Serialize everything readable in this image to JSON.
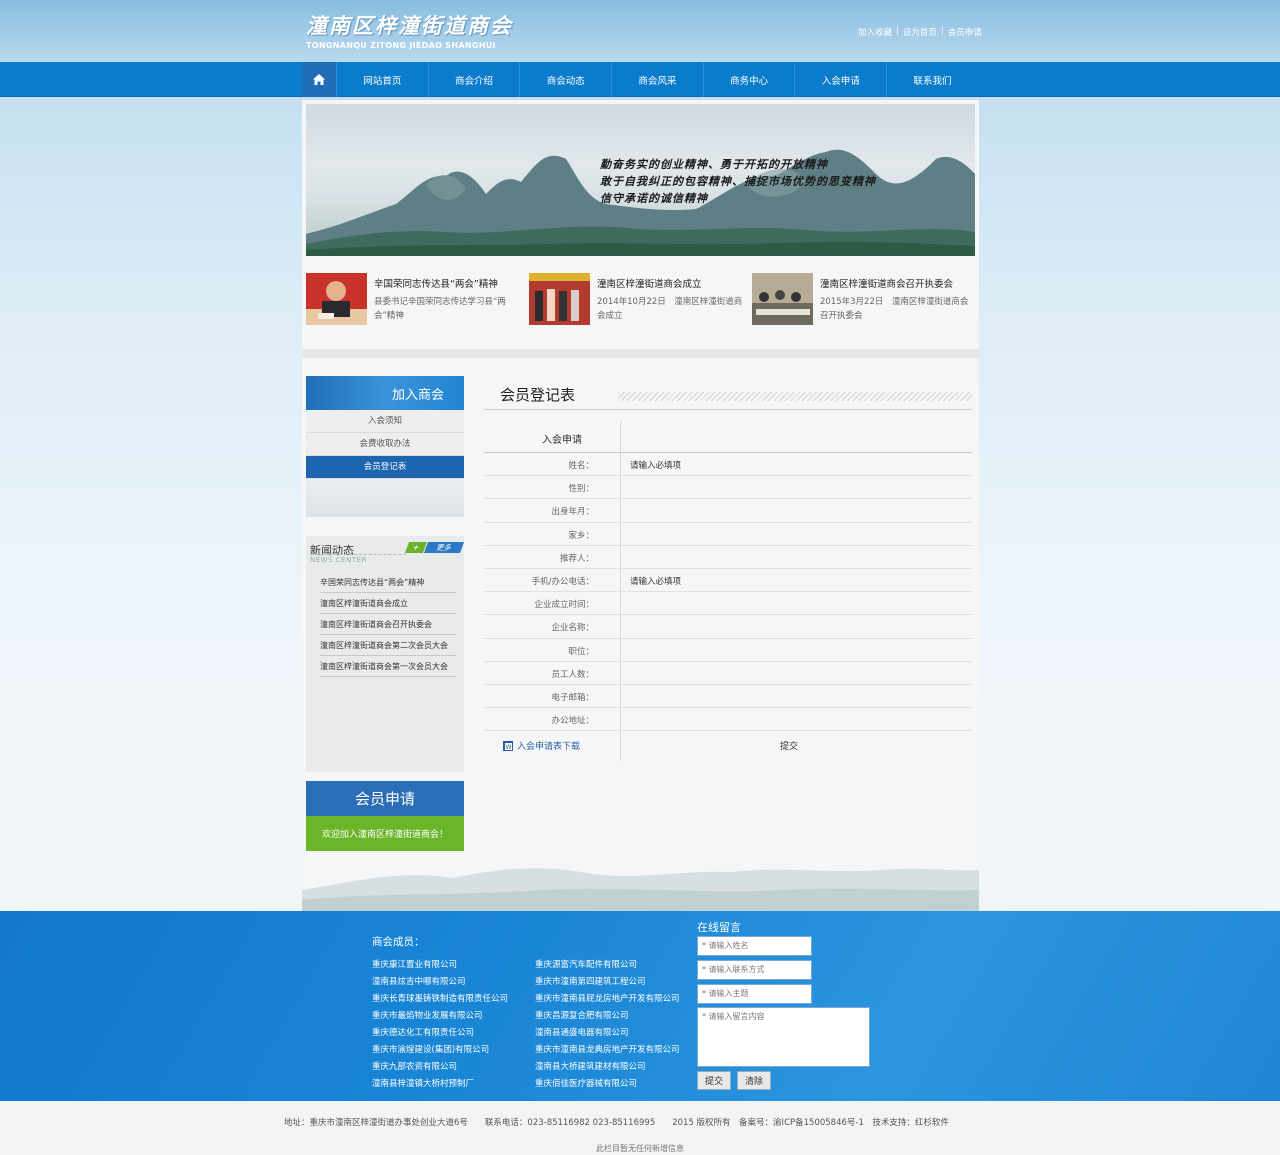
{
  "header": {
    "logo_cn": "潼南区梓潼街道商会",
    "logo_en": "TONGNANQU  ZITONG JIEDAO SHANGHUI",
    "links": [
      "加入收藏",
      "设为首页",
      "会员申请"
    ]
  },
  "nav": {
    "items": [
      "网站首页",
      "商会介绍",
      "商会动态",
      "商会风采",
      "商务中心",
      "入会申请",
      "联系我们"
    ]
  },
  "banner": {
    "slogan": [
      "勤奋务实的创业精神、勇于开拓的开放精神",
      "敢于自我纠正的包容精神、捕捉市场优势的思变精神",
      "信守承诺的诚信精神"
    ]
  },
  "news_cards": [
    {
      "title": "辛国荣同志传达县“两会”精神",
      "desc": "县委书记辛国荣同志传达学习县“两会”精神"
    },
    {
      "title": "潼南区梓潼街道商会成立",
      "desc": "2014年10月22日　潼南区梓潼街道商会成立"
    },
    {
      "title": "潼南区梓潼街道商会召开执委会",
      "desc": "2015年3月22日　潼南区梓潼街道商会召开执委会"
    }
  ],
  "sidebar": {
    "title": "加入商会",
    "items": [
      "入会须知",
      "会费收取办法",
      "会员登记表"
    ]
  },
  "newsbox": {
    "title": "新闻动态",
    "subtitle": "NEWS CENTER",
    "more_plus": "+",
    "more": "更多",
    "items": [
      "辛国荣同志传达县“两会”精神",
      "潼南区梓潼街道商会成立",
      "潼南区梓潼街道商会召开执委会",
      "潼南区梓潼街道商会第二次会员大会",
      "潼南区梓潼街道商会第一次会员大会"
    ]
  },
  "member_box": {
    "title": "会员申请",
    "welcome": "欢迎加入潼南区梓潼街道商会！"
  },
  "form": {
    "title": "会员登记表",
    "head": "入会申请",
    "rows": [
      {
        "label": "姓名：",
        "value": "请输入必填项"
      },
      {
        "label": "性别：",
        "value": ""
      },
      {
        "label": "出身年月：",
        "value": ""
      },
      {
        "label": "家乡：",
        "value": ""
      },
      {
        "label": "推荐人：",
        "value": ""
      },
      {
        "label": "手机/办公电话：",
        "value": "请输入必填项"
      },
      {
        "label": "企业成立时间：",
        "value": ""
      },
      {
        "label": "企业名称：",
        "value": ""
      },
      {
        "label": "职位：",
        "value": ""
      },
      {
        "label": "员工人数：",
        "value": ""
      },
      {
        "label": "电子邮箱：",
        "value": ""
      },
      {
        "label": "办公地址：",
        "value": ""
      }
    ],
    "download": "入会申请表下载",
    "submit": "提交"
  },
  "footer": {
    "members_title": "商会成员：",
    "members_left": [
      "重庆康江置业有限公司",
      "潼南县炫吉中哪有限公司",
      "重庆长青球墨铸铁制造有限责任公司",
      "重庆市最焰物业发展有限公司",
      "重庆德达化工有限责任公司",
      "重庆市渝煌建设(集团)有限公司",
      "重庆九部农资有限公司",
      "潼南县梓潼镇大桥村预制厂"
    ],
    "members_right": [
      "重庆源富汽车配件有限公司",
      "重庆市潼南第四建筑工程公司",
      "重庆市潼南县屁龙房地产开发有限公司",
      "重庆昌源复合肥有限公司",
      "潼南县通盛电器有限公司",
      "重庆市潼南县龙典房地产开发有限公司",
      "潼南县大桥建筑建材有限公司",
      "重庆佰佳医疗器械有限公司"
    ],
    "msg_title": "在线留言",
    "ph_name": "* 请输入姓名",
    "ph_contact": "* 请输入联系方式",
    "ph_subject": "* 请输入主题",
    "ph_content": "* 请输入留言内容",
    "btn_submit": "提交",
    "btn_clear": "清除",
    "info": "地址：重庆市潼南区梓潼街道办事处创业大道6号　　联系电话：023-85116982 023-85116995　　2015 版权所有　备案号：渝ICP备15005846号-1　技术支持：红杉软件",
    "note": "此栏目暂无任何新增信息"
  },
  "colors": {
    "nav_blue": "#0b7ccc",
    "active_blue": "#1e65b1",
    "green": "#6ab52a",
    "footer_blue": "#1a86d6"
  }
}
